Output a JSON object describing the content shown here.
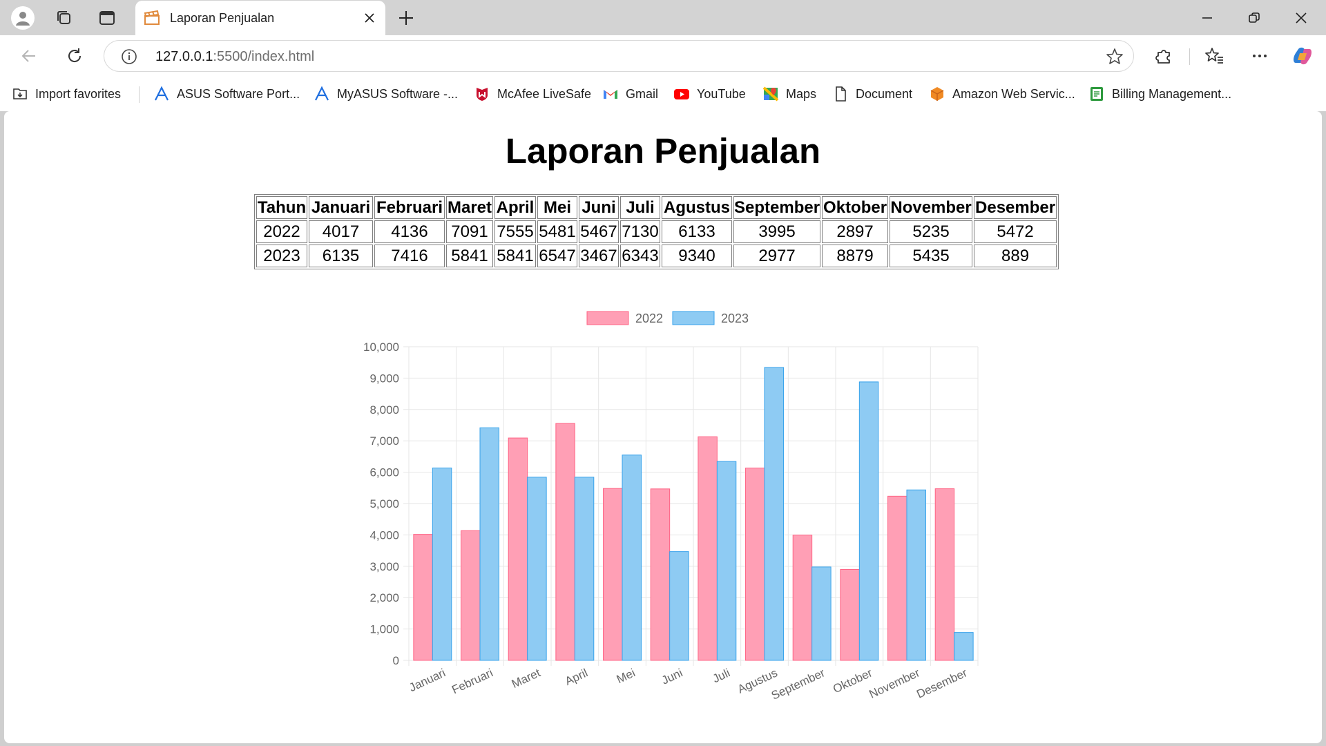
{
  "browser": {
    "tab_title": "Laporan Penjualan",
    "url_host": "127.0.0.1",
    "url_rest": ":5500/index.html"
  },
  "bookmarks": [
    {
      "label": "Import favorites",
      "icon": "import-favorites-icon"
    },
    {
      "label": "ASUS Software Port...",
      "icon": "asus-icon"
    },
    {
      "label": "MyASUS Software -...",
      "icon": "asus-icon"
    },
    {
      "label": "McAfee LiveSafe",
      "icon": "mcafee-icon"
    },
    {
      "label": "Gmail",
      "icon": "gmail-icon"
    },
    {
      "label": "YouTube",
      "icon": "youtube-icon"
    },
    {
      "label": "Maps",
      "icon": "maps-icon"
    },
    {
      "label": "Document",
      "icon": "document-icon"
    },
    {
      "label": "Amazon Web Servic...",
      "icon": "aws-icon"
    },
    {
      "label": "Billing Management...",
      "icon": "billing-icon"
    }
  ],
  "page": {
    "title": "Laporan Penjualan"
  },
  "table": {
    "headers": [
      "Tahun",
      "Januari",
      "Februari",
      "Maret",
      "April",
      "Mei",
      "Juni",
      "Juli",
      "Agustus",
      "September",
      "Oktober",
      "November",
      "Desember"
    ],
    "rows": [
      [
        "2022",
        "4017",
        "4136",
        "7091",
        "7555",
        "5481",
        "5467",
        "7130",
        "6133",
        "3995",
        "2897",
        "5235",
        "5472"
      ],
      [
        "2023",
        "6135",
        "7416",
        "5841",
        "5841",
        "6547",
        "3467",
        "6343",
        "9340",
        "2977",
        "8879",
        "5435",
        "889"
      ]
    ]
  },
  "chart_data": {
    "type": "bar",
    "categories": [
      "Januari",
      "Februari",
      "Maret",
      "April",
      "Mei",
      "Juni",
      "Juli",
      "Agustus",
      "September",
      "Oktober",
      "November",
      "Desember"
    ],
    "series": [
      {
        "name": "2022",
        "values": [
          4017,
          4136,
          7091,
          7555,
          5481,
          5467,
          7130,
          6133,
          3995,
          2897,
          5235,
          5472
        ],
        "fill": "#ff9fb5",
        "stroke": "#ff6384"
      },
      {
        "name": "2023",
        "values": [
          6135,
          7416,
          5841,
          5841,
          6547,
          3467,
          6343,
          9340,
          2977,
          8879,
          5435,
          889
        ],
        "fill": "#8ecbf3",
        "stroke": "#36a2eb"
      }
    ],
    "ylim": [
      0,
      10000
    ],
    "yticks": [
      "0",
      "1,000",
      "2,000",
      "3,000",
      "4,000",
      "5,000",
      "6,000",
      "7,000",
      "8,000",
      "9,000",
      "10,000"
    ],
    "grid": true,
    "legend": "top-center"
  }
}
